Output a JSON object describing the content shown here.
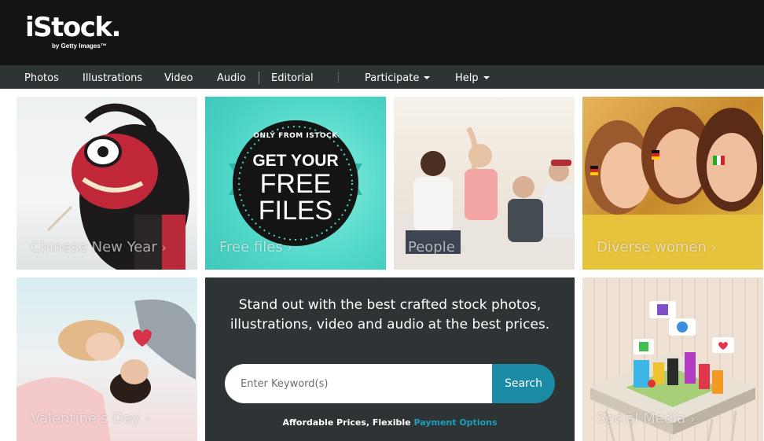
{
  "logo": {
    "name": "iStock.",
    "byline": "by Getty Images™"
  },
  "nav": {
    "photos": "Photos",
    "illustrations": "Illustrations",
    "video": "Video",
    "audio": "Audio",
    "editorial": "Editorial",
    "participate": "Participate",
    "help": "Help"
  },
  "tiles": [
    {
      "caption": "Chinese New Year",
      "chevron": "›"
    },
    {
      "caption": "Free files",
      "chevron": "›",
      "badge_top": "ONLY FROM ISTOCK",
      "badge_line1": "GET YOUR",
      "badge_line2": "FREE",
      "badge_line3": "FILES"
    },
    {
      "caption": "People",
      "chevron": "›"
    },
    {
      "caption": "Diverse women",
      "chevron": "›"
    },
    {
      "caption": "Valentine's Day",
      "chevron": "›"
    },
    {
      "caption": "Social Media",
      "chevron": "›"
    }
  ],
  "promo": {
    "headline_line1": "Stand out with the best crafted stock photos,",
    "headline_line2": "illustrations, video and audio at the best prices.",
    "search_placeholder": "Enter Keyword(s)",
    "search_button": "Search",
    "footer_text": "Affordable Prices, Flexible",
    "footer_link": "Payment Options"
  },
  "colors": {
    "header_bg": "#141414",
    "nav_bg": "#2e3436",
    "promo_bg": "#2e3436",
    "accent": "#1a8aa5",
    "link": "#1a9fbf",
    "free_files_teal": "#4fd7c8"
  }
}
